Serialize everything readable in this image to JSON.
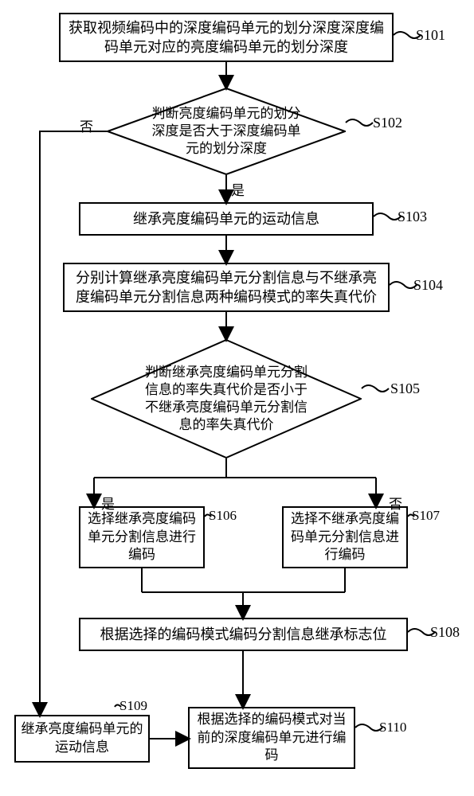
{
  "chart_data": {
    "type": "flowchart",
    "nodes": [
      {
        "id": "S101",
        "type": "process",
        "text": "获取视频编码中的深度编码单元的划分深度深度编码单元对应的亮度编码单元的划分深度"
      },
      {
        "id": "S102",
        "type": "decision",
        "text": "判断亮度编码单元的划分深度是否大于深度编码单元的划分深度"
      },
      {
        "id": "S103",
        "type": "process",
        "text": "继承亮度编码单元的运动信息"
      },
      {
        "id": "S104",
        "type": "process",
        "text": "分别计算继承亮度编码单元分割信息与不继承亮度编码单元分割信息两种编码模式的率失真代价"
      },
      {
        "id": "S105",
        "type": "decision",
        "text": "判断继承亮度编码单元分割信息的率失真代价是否小于不继承亮度编码单元分割信息的率失真代价"
      },
      {
        "id": "S106",
        "type": "process",
        "text": "选择继承亮度编码单元分割信息进行编码"
      },
      {
        "id": "S107",
        "type": "process",
        "text": "选择不继承亮度编码单元分割信息进行编码"
      },
      {
        "id": "S108",
        "type": "process",
        "text": "根据选择的编码模式编码分割信息继承标志位"
      },
      {
        "id": "S109",
        "type": "process",
        "text": "继承亮度编码单元的运动信息"
      },
      {
        "id": "S110",
        "type": "process",
        "text": "根据选择的编码模式对当前的深度编码单元进行编码"
      }
    ],
    "edges": [
      {
        "from": "S101",
        "to": "S102"
      },
      {
        "from": "S102",
        "to": "S103",
        "label": "是"
      },
      {
        "from": "S102",
        "to": "S109",
        "label": "否"
      },
      {
        "from": "S103",
        "to": "S104"
      },
      {
        "from": "S104",
        "to": "S105"
      },
      {
        "from": "S105",
        "to": "S106",
        "label": "是"
      },
      {
        "from": "S105",
        "to": "S107",
        "label": "否"
      },
      {
        "from": "S106",
        "to": "S108"
      },
      {
        "from": "S107",
        "to": "S108"
      },
      {
        "from": "S108",
        "to": "S110"
      },
      {
        "from": "S109",
        "to": "S110"
      }
    ]
  },
  "labels": {
    "s101": "S101",
    "s102": "S102",
    "s103": "S103",
    "s104": "S104",
    "s105": "S105",
    "s106": "S106",
    "s107": "S107",
    "s108": "S108",
    "s109": "S109",
    "s110": "S110",
    "yes": "是",
    "no": "否"
  },
  "text": {
    "n101": "获取视频编码中的深度编码单元的划分深度深度编码单元对应的亮度编码单元的划分深度",
    "n102": "判断亮度编码单元的划分深度是否大于深度编码单元的划分深度",
    "n103": "继承亮度编码单元的运动信息",
    "n104": "分别计算继承亮度编码单元分割信息与不继承亮度编码单元分割信息两种编码模式的率失真代价",
    "n105": "判断继承亮度编码单元分割信息的率失真代价是否小于不继承亮度编码单元分割信息的率失真代价",
    "n106": "选择继承亮度编码单元分割信息进行编码",
    "n107": "选择不继承亮度编码单元分割信息进行编码",
    "n108": "根据选择的编码模式编码分割信息继承标志位",
    "n109": "继承亮度编码单元的运动信息",
    "n110": "根据选择的编码模式对当前的深度编码单元进行编码"
  }
}
